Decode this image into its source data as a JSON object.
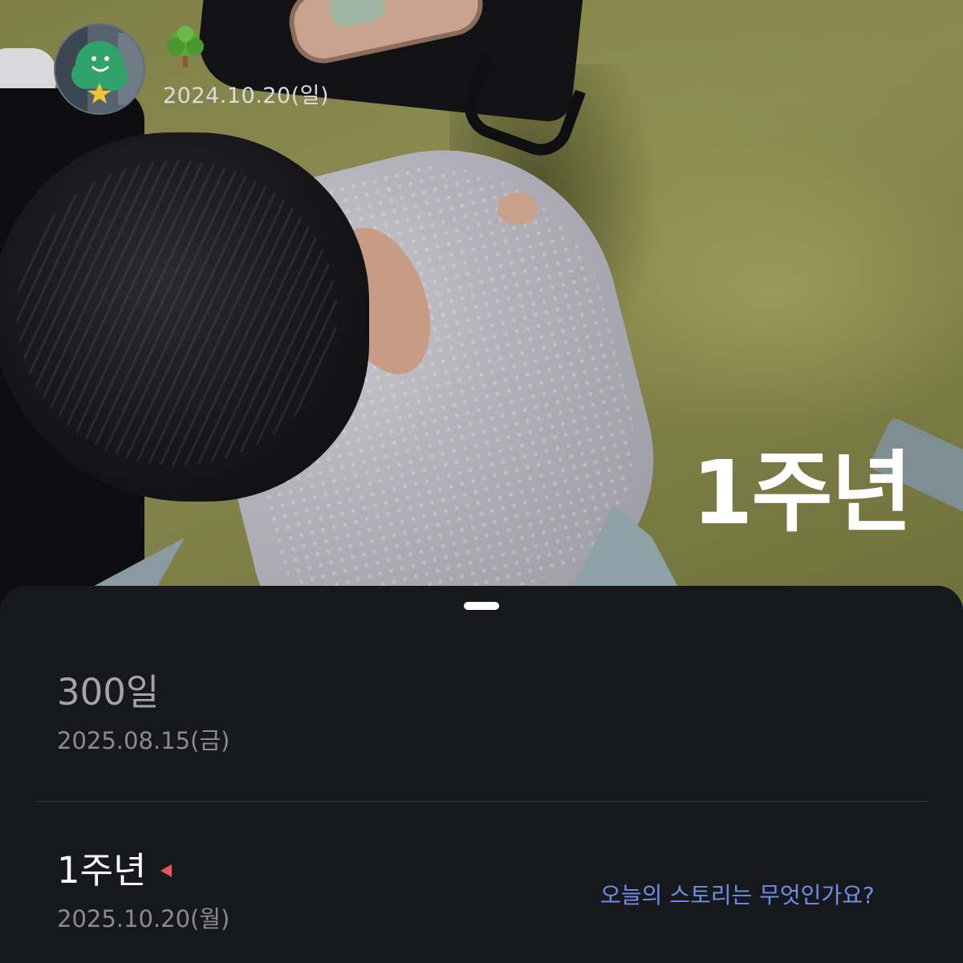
{
  "header": {
    "start_date": "2024.10.20(일)",
    "avatar_icon": "smiling-tree-avatar",
    "mood_icon": "tree-icon"
  },
  "photo": {
    "overlay_title": "1주년"
  },
  "timeline": {
    "items": [
      {
        "title": "300일",
        "date": "2025.08.15(금)"
      },
      {
        "title": "1주년",
        "date": "2025.10.20(월)",
        "marker_icon": "heart-marker-icon"
      }
    ]
  },
  "story_prompt": "오늘의 스토리는 무엇인가요?",
  "colors": {
    "sheet_background": "#17181c",
    "link": "#6e8fe8",
    "marker": "#e8575a"
  }
}
